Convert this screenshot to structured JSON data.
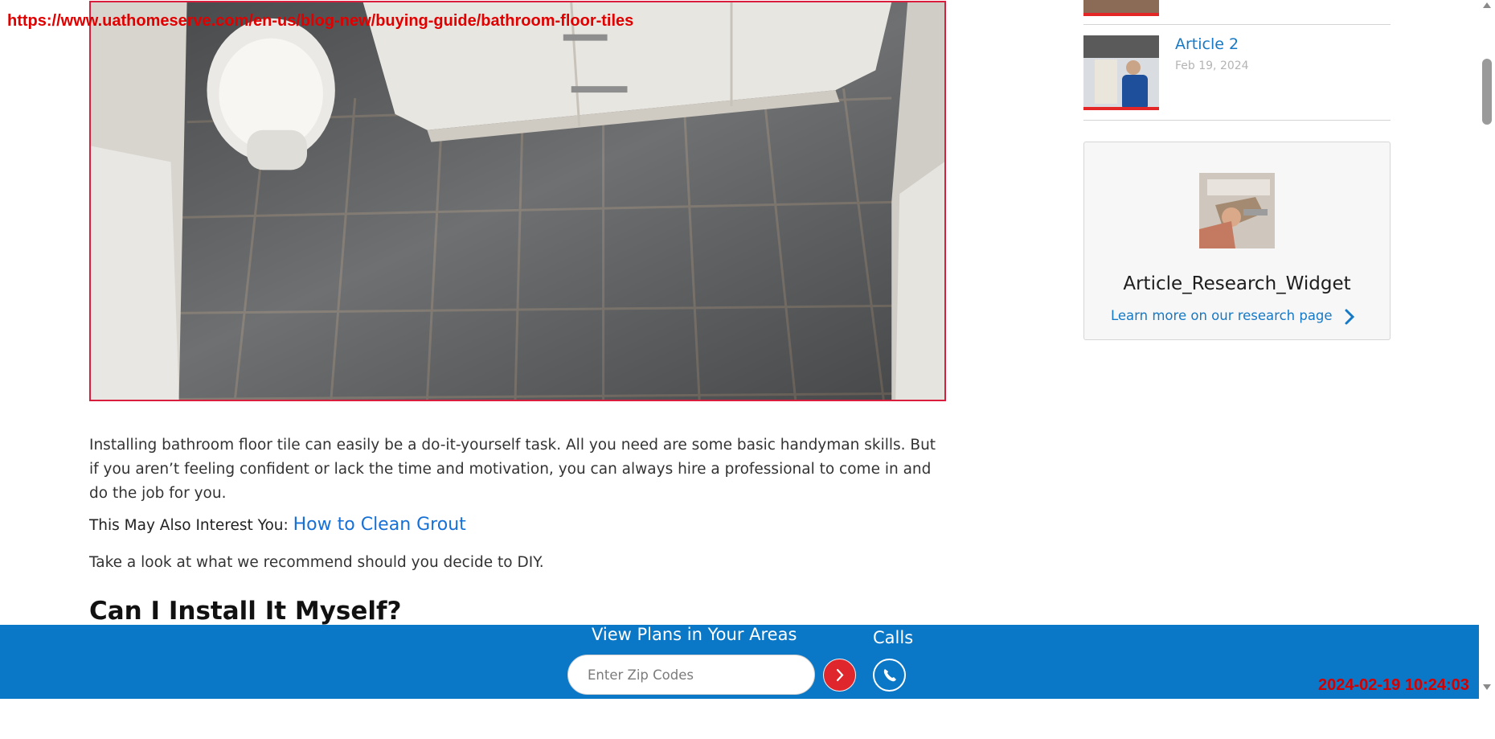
{
  "overlay": {
    "url": "https://www.uathomeserve.com/en-us/blog-new/buying-guide/bathroom-floor-tiles",
    "timestamp": "2024-02-19 10:24:03"
  },
  "article": {
    "hero_image": "bathroom-floor-tile-photo",
    "paragraph_1": "Installing bathroom floor tile can easily be a do-it-yourself task. All you need are some basic handyman skills. But if you aren’t feeling confident or lack the time and motivation, you can always hire a professional to come in and do the job for you.",
    "interest_prefix": "This May Also Interest You:",
    "interest_link": "How to Clean Grout",
    "paragraph_2": "Take a look at what we recommend should you decide to DIY.",
    "heading": "Can I Install It Myself?"
  },
  "sidebar": {
    "articles": [
      {
        "title": "Article 2",
        "date": "Feb 19, 2024"
      }
    ],
    "widget": {
      "title": "Article_Research_Widget",
      "link": "Learn more on our research page"
    }
  },
  "bottom_bar": {
    "plans_label": "View Plans in Your Areas",
    "zip_placeholder": "Enter Zip Codes",
    "calls_label": "Calls"
  },
  "colors": {
    "brand_blue": "#0a78c7",
    "brand_red": "#e0262d",
    "link_blue": "#1670d6"
  },
  "icons": [
    "chevron-right-icon",
    "phone-icon",
    "scroll-up-arrow-icon",
    "scroll-down-arrow-icon"
  ]
}
